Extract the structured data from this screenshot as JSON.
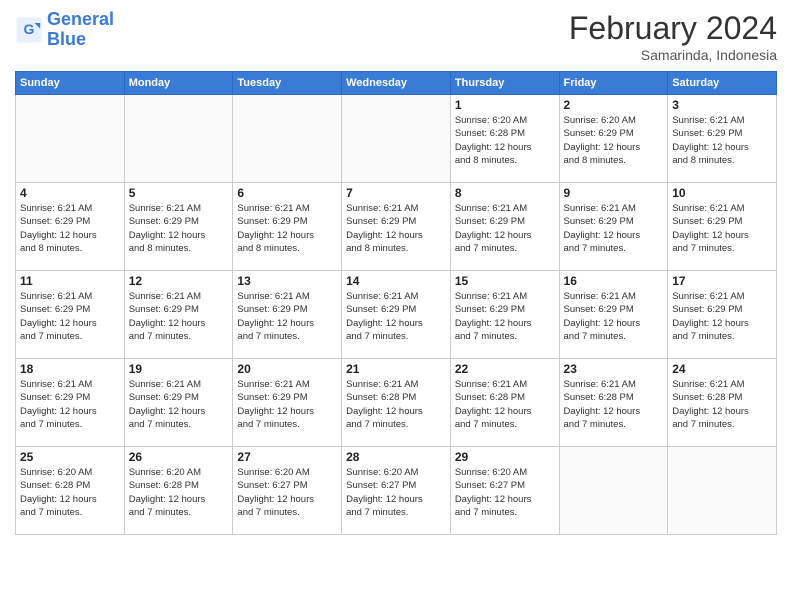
{
  "logo": {
    "line1": "General",
    "line2": "Blue"
  },
  "title": "February 2024",
  "subtitle": "Samarinda, Indonesia",
  "days_of_week": [
    "Sunday",
    "Monday",
    "Tuesday",
    "Wednesday",
    "Thursday",
    "Friday",
    "Saturday"
  ],
  "weeks": [
    [
      {
        "day": "",
        "info": ""
      },
      {
        "day": "",
        "info": ""
      },
      {
        "day": "",
        "info": ""
      },
      {
        "day": "",
        "info": ""
      },
      {
        "day": "1",
        "info": "Sunrise: 6:20 AM\nSunset: 6:28 PM\nDaylight: 12 hours\nand 8 minutes."
      },
      {
        "day": "2",
        "info": "Sunrise: 6:20 AM\nSunset: 6:29 PM\nDaylight: 12 hours\nand 8 minutes."
      },
      {
        "day": "3",
        "info": "Sunrise: 6:21 AM\nSunset: 6:29 PM\nDaylight: 12 hours\nand 8 minutes."
      }
    ],
    [
      {
        "day": "4",
        "info": "Sunrise: 6:21 AM\nSunset: 6:29 PM\nDaylight: 12 hours\nand 8 minutes."
      },
      {
        "day": "5",
        "info": "Sunrise: 6:21 AM\nSunset: 6:29 PM\nDaylight: 12 hours\nand 8 minutes."
      },
      {
        "day": "6",
        "info": "Sunrise: 6:21 AM\nSunset: 6:29 PM\nDaylight: 12 hours\nand 8 minutes."
      },
      {
        "day": "7",
        "info": "Sunrise: 6:21 AM\nSunset: 6:29 PM\nDaylight: 12 hours\nand 8 minutes."
      },
      {
        "day": "8",
        "info": "Sunrise: 6:21 AM\nSunset: 6:29 PM\nDaylight: 12 hours\nand 7 minutes."
      },
      {
        "day": "9",
        "info": "Sunrise: 6:21 AM\nSunset: 6:29 PM\nDaylight: 12 hours\nand 7 minutes."
      },
      {
        "day": "10",
        "info": "Sunrise: 6:21 AM\nSunset: 6:29 PM\nDaylight: 12 hours\nand 7 minutes."
      }
    ],
    [
      {
        "day": "11",
        "info": "Sunrise: 6:21 AM\nSunset: 6:29 PM\nDaylight: 12 hours\nand 7 minutes."
      },
      {
        "day": "12",
        "info": "Sunrise: 6:21 AM\nSunset: 6:29 PM\nDaylight: 12 hours\nand 7 minutes."
      },
      {
        "day": "13",
        "info": "Sunrise: 6:21 AM\nSunset: 6:29 PM\nDaylight: 12 hours\nand 7 minutes."
      },
      {
        "day": "14",
        "info": "Sunrise: 6:21 AM\nSunset: 6:29 PM\nDaylight: 12 hours\nand 7 minutes."
      },
      {
        "day": "15",
        "info": "Sunrise: 6:21 AM\nSunset: 6:29 PM\nDaylight: 12 hours\nand 7 minutes."
      },
      {
        "day": "16",
        "info": "Sunrise: 6:21 AM\nSunset: 6:29 PM\nDaylight: 12 hours\nand 7 minutes."
      },
      {
        "day": "17",
        "info": "Sunrise: 6:21 AM\nSunset: 6:29 PM\nDaylight: 12 hours\nand 7 minutes."
      }
    ],
    [
      {
        "day": "18",
        "info": "Sunrise: 6:21 AM\nSunset: 6:29 PM\nDaylight: 12 hours\nand 7 minutes."
      },
      {
        "day": "19",
        "info": "Sunrise: 6:21 AM\nSunset: 6:29 PM\nDaylight: 12 hours\nand 7 minutes."
      },
      {
        "day": "20",
        "info": "Sunrise: 6:21 AM\nSunset: 6:29 PM\nDaylight: 12 hours\nand 7 minutes."
      },
      {
        "day": "21",
        "info": "Sunrise: 6:21 AM\nSunset: 6:28 PM\nDaylight: 12 hours\nand 7 minutes."
      },
      {
        "day": "22",
        "info": "Sunrise: 6:21 AM\nSunset: 6:28 PM\nDaylight: 12 hours\nand 7 minutes."
      },
      {
        "day": "23",
        "info": "Sunrise: 6:21 AM\nSunset: 6:28 PM\nDaylight: 12 hours\nand 7 minutes."
      },
      {
        "day": "24",
        "info": "Sunrise: 6:21 AM\nSunset: 6:28 PM\nDaylight: 12 hours\nand 7 minutes."
      }
    ],
    [
      {
        "day": "25",
        "info": "Sunrise: 6:20 AM\nSunset: 6:28 PM\nDaylight: 12 hours\nand 7 minutes."
      },
      {
        "day": "26",
        "info": "Sunrise: 6:20 AM\nSunset: 6:28 PM\nDaylight: 12 hours\nand 7 minutes."
      },
      {
        "day": "27",
        "info": "Sunrise: 6:20 AM\nSunset: 6:27 PM\nDaylight: 12 hours\nand 7 minutes."
      },
      {
        "day": "28",
        "info": "Sunrise: 6:20 AM\nSunset: 6:27 PM\nDaylight: 12 hours\nand 7 minutes."
      },
      {
        "day": "29",
        "info": "Sunrise: 6:20 AM\nSunset: 6:27 PM\nDaylight: 12 hours\nand 7 minutes."
      },
      {
        "day": "",
        "info": ""
      },
      {
        "day": "",
        "info": ""
      }
    ]
  ]
}
